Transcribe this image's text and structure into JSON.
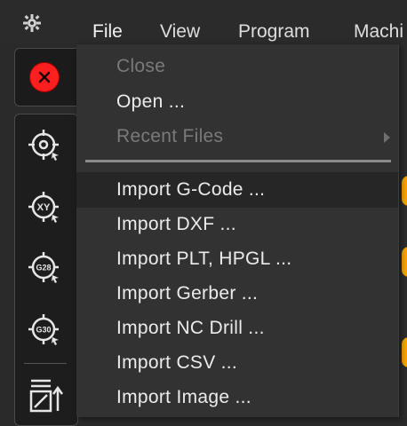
{
  "menubar": {
    "app_icon": "gear-bug-icon",
    "menus": [
      {
        "label": "File",
        "active": true
      },
      {
        "label": "View",
        "active": false
      },
      {
        "label": "Program",
        "active": false
      },
      {
        "label": "Machi",
        "active": false
      }
    ]
  },
  "close_panel": {
    "icon": "close-circle-icon",
    "color": "#ff1f1f"
  },
  "toolbar": {
    "tools": [
      {
        "icon": "touch-off-icon",
        "text": ""
      },
      {
        "icon": "touch-off-xy-icon",
        "text": "XY"
      },
      {
        "icon": "touch-off-g28-icon",
        "text": "G28"
      },
      {
        "icon": "touch-off-g30-icon",
        "text": "G30"
      },
      {
        "icon": "zero-axis-icon",
        "text": ""
      }
    ]
  },
  "file_menu": {
    "items": [
      {
        "label": "Close",
        "enabled": false
      },
      {
        "label": "Open ...",
        "enabled": true
      },
      {
        "label": "Recent Files",
        "enabled": false,
        "submenu": true
      },
      {
        "label": "Import G-Code ...",
        "enabled": true,
        "highlighted": true
      },
      {
        "label": "Import DXF ...",
        "enabled": true
      },
      {
        "label": "Import PLT, HPGL ...",
        "enabled": true
      },
      {
        "label": "Import Gerber ...",
        "enabled": true
      },
      {
        "label": "Import NC Drill ...",
        "enabled": true
      },
      {
        "label": "Import CSV ...",
        "enabled": true
      },
      {
        "label": "Import Image ...",
        "enabled": true
      }
    ]
  },
  "colors": {
    "accent": "#f4a300",
    "menu_bg": "#323232",
    "close_red": "#ff1f1f"
  }
}
